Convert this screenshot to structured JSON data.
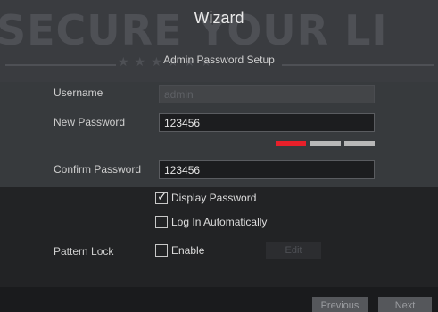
{
  "wizard": {
    "title": "Wizard",
    "watermark": "SECURE YOUR LI",
    "subtitle": "Admin Password Setup"
  },
  "form": {
    "username_label": "Username",
    "username_value": "admin",
    "new_password_label": "New Password",
    "new_password_value": "123456",
    "password_strength": {
      "level": 1,
      "max": 3,
      "active_color": "#e8202a",
      "inactive_color": "#b8b8b8"
    },
    "confirm_password_label": "Confirm Password",
    "confirm_password_value": "123456",
    "display_password_label": "Display Password",
    "display_password_checked": true,
    "log_in_auto_label": "Log In Automatically",
    "log_in_auto_checked": false,
    "pattern_lock_label": "Pattern Lock",
    "enable_label": "Enable",
    "enable_checked": false,
    "edit_label": "Edit"
  },
  "footer": {
    "previous_label": "Previous",
    "next_label": "Next"
  },
  "colors": {
    "banner_bg": "#3a3c40",
    "panel_bg": "#373a3d",
    "lower_bg": "#222325",
    "accent_red": "#e8202a"
  }
}
